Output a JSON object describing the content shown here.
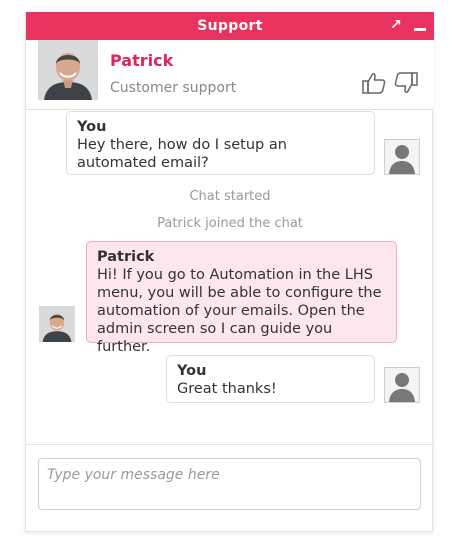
{
  "window": {
    "title": "Support",
    "popout_glyph": "↗"
  },
  "agent": {
    "name": "Patrick",
    "role": "Customer support",
    "photo_icon": "agent-portrait",
    "rate_up_icon": "thumbs-up-icon",
    "rate_down_icon": "thumbs-down-icon"
  },
  "messages": [
    {
      "sender": "You",
      "text": "Hey there, how do I setup an automated email?"
    },
    {
      "sender": "Patrick",
      "text": "Hi! If you go to Automation in the LHS menu, you will be able to configure the automation of your emails.  Open the admin screen so I can guide you further."
    },
    {
      "sender": "You",
      "text": "Great thanks!"
    }
  ],
  "system": {
    "chat_started": "Chat started",
    "agent_joined": "Patrick joined the chat"
  },
  "composer": {
    "placeholder": "Type your message here",
    "value": ""
  },
  "colors": {
    "accent": "#e8325f",
    "agent_name": "#e0245a",
    "agent_bubble": "#fde6ee",
    "agent_bubble_border": "#f2a8bf"
  }
}
